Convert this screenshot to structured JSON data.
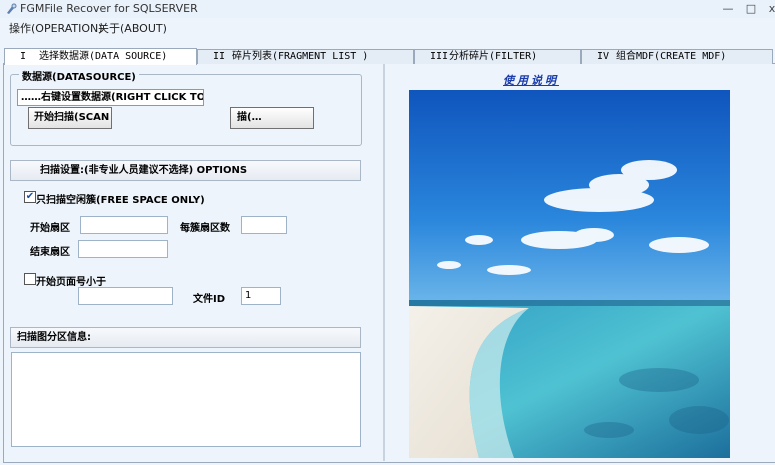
{
  "window": {
    "title": "FGMFile Recover for SQLSERVER",
    "minimize_glyph": "—",
    "maximize_glyph": "□",
    "close_glyph": "x"
  },
  "menu": [
    {
      "label": "操作(OPERATION)"
    },
    {
      "label": "关于(ABOUT)"
    }
  ],
  "tabs": [
    {
      "num": "I",
      "label": "选择数据源(DATA SOURCE)",
      "active": true
    },
    {
      "num": "II",
      "label": "碎片列表(FRAGMENT LIST )",
      "active": false
    },
    {
      "num": "III",
      "label": "分析碎片(FILTER)",
      "active": false
    },
    {
      "num": "IV",
      "label": "组合MDF(CREATE MDF)",
      "active": false
    }
  ],
  "datasource": {
    "legend": "数据源(DATASOURCE)",
    "field_value": "……右键设置数据源(RIGHT CLICK TO D",
    "scan_button": "开始扫描(SCAN",
    "second_button": "描(…"
  },
  "options": {
    "header": "扫描设置:(非专业人员建议不选择) OPTIONS",
    "free_space_label": "只扫描空闲簇(FREE SPACE ONLY)",
    "free_space_checked": true,
    "free_space_mark": "✔",
    "start_sector_label": "开始扇区",
    "start_sector_value": "",
    "sectors_per_cluster_label": "每簇扇区数",
    "sectors_per_cluster_value": "",
    "end_sector_label": "结束扇区",
    "end_sector_value": "",
    "page_less_than_label": "开始页面号小于",
    "page_less_than_checked": false,
    "page_less_than_value": "",
    "file_id_label": "文件ID",
    "file_id_value": "1"
  },
  "partition": {
    "header": "扫描图分区信息:",
    "content": ""
  },
  "right": {
    "help_link": "使用说明",
    "image_desc": "beach-image"
  },
  "colors": {
    "window_bg": "#eef4fb",
    "link": "#1a3ca8",
    "sky": "#1f6fd0",
    "sea": "#37a8c4"
  }
}
